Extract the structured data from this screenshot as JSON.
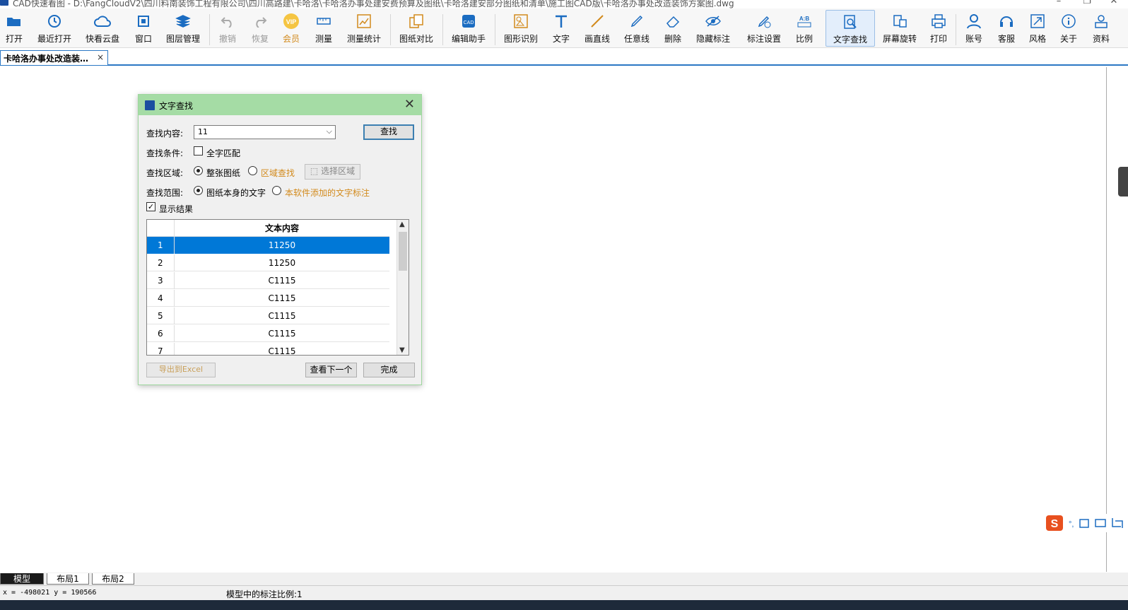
{
  "window": {
    "title": "CAD快速看图 - D:\\FangCloudV2\\四川料南装饰工程有限公司\\四川高路建\\卡哈洛\\卡哈洛办事处建安费预算及图纸\\卡哈洛建安部分图纸和清单\\施工图CAD版\\卡哈洛办事处改造装饰方案图.dwg"
  },
  "toolbar": {
    "items": [
      {
        "id": "open",
        "label": "打开",
        "icon": "folder-icon"
      },
      {
        "id": "recent",
        "label": "最近打开",
        "icon": "clock-icon"
      },
      {
        "id": "cloud",
        "label": "快看云盘",
        "icon": "cloud-icon"
      },
      {
        "id": "window",
        "label": "窗口",
        "icon": "window-icon"
      },
      {
        "id": "layers",
        "label": "图层管理",
        "icon": "layers-icon"
      },
      {
        "id": "undo",
        "label": "撤销",
        "icon": "undo-icon"
      },
      {
        "id": "redo",
        "label": "恢复",
        "icon": "redo-icon"
      },
      {
        "id": "vip",
        "label": "会员",
        "icon": "vip-icon"
      },
      {
        "id": "measure",
        "label": "测量",
        "icon": "ruler-icon"
      },
      {
        "id": "measure-stats",
        "label": "测量统计",
        "icon": "chart-icon"
      },
      {
        "id": "compare",
        "label": "图纸对比",
        "icon": "compare-icon"
      },
      {
        "id": "edit-assist",
        "label": "编辑助手",
        "icon": "cad-edit-icon"
      },
      {
        "id": "shape-recog",
        "label": "图形识别",
        "icon": "shape-recognition-icon"
      },
      {
        "id": "text",
        "label": "文字",
        "icon": "text-icon"
      },
      {
        "id": "line",
        "label": "画直线",
        "icon": "line-icon"
      },
      {
        "id": "freeline",
        "label": "任意线",
        "icon": "pen-icon"
      },
      {
        "id": "delete",
        "label": "删除",
        "icon": "eraser-icon"
      },
      {
        "id": "hide-annot",
        "label": "隐藏标注",
        "icon": "eye-icon"
      },
      {
        "id": "annot-settings",
        "label": "标注设置",
        "icon": "annotation-settings-icon"
      },
      {
        "id": "scale",
        "label": "比例",
        "icon": "scale-icon"
      },
      {
        "id": "text-search",
        "label": "文字查找",
        "icon": "text-search-icon"
      },
      {
        "id": "rotate",
        "label": "屏幕旋转",
        "icon": "rotate-icon"
      },
      {
        "id": "print",
        "label": "打印",
        "icon": "printer-icon"
      },
      {
        "id": "account",
        "label": "账号",
        "icon": "user-icon"
      },
      {
        "id": "support",
        "label": "客服",
        "icon": "headset-icon"
      },
      {
        "id": "style",
        "label": "风格",
        "icon": "style-icon"
      },
      {
        "id": "about",
        "label": "关于",
        "icon": "info-icon"
      },
      {
        "id": "resources",
        "label": "资料",
        "icon": "resources-icon"
      }
    ]
  },
  "doc_tab": {
    "label": "卡哈洛办事处改造装…",
    "close": "×"
  },
  "dialog": {
    "title": "文字查找",
    "close": "✕",
    "search_label": "查找内容:",
    "search_value": "11",
    "search_button": "查找",
    "condition_label": "查找条件:",
    "whole_word": "全字匹配",
    "area_label": "查找区域:",
    "area_whole": "整张图纸",
    "area_region": "区域查找",
    "select_region": "选择区域",
    "range_label": "查找范围:",
    "range_drawing": "图纸本身的文字",
    "range_added": "本软件添加的文字标注",
    "show_results": "显示结果",
    "table_header": "文本内容",
    "rows": [
      {
        "index": "1",
        "text": "11250"
      },
      {
        "index": "2",
        "text": "11250"
      },
      {
        "index": "3",
        "text": "C1115"
      },
      {
        "index": "4",
        "text": "C1115"
      },
      {
        "index": "5",
        "text": "C1115"
      },
      {
        "index": "6",
        "text": "C1115"
      },
      {
        "index": "7",
        "text": "C1115"
      }
    ],
    "export_button": "导出到Excel",
    "next_button": "查看下一个",
    "done_button": "完成"
  },
  "layout_tabs": [
    "模型",
    "布局1",
    "布局2"
  ],
  "status": {
    "coords": "x = -498021  y = 190566",
    "scale_text": "模型中的标注比例:1"
  },
  "colors": {
    "dialog_title_bg": "#a5dca5",
    "selection": "#0078d7",
    "accent_orange": "#d28a1c"
  }
}
